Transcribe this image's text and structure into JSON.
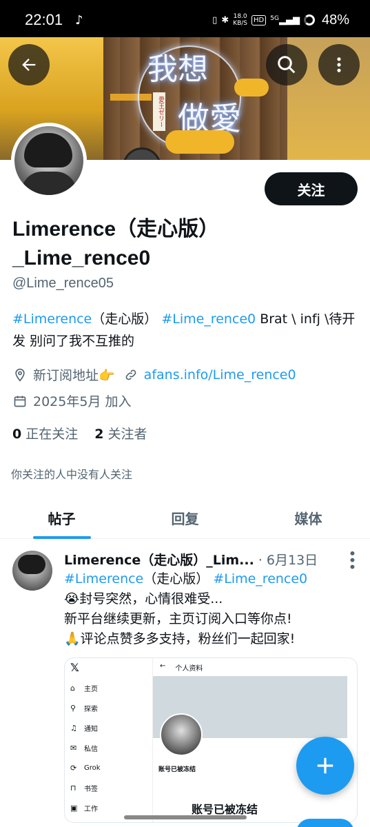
{
  "status_bar": {
    "time": "22:01",
    "net_speed_value": "18.0",
    "net_speed_unit": "KB/S",
    "hd_label": "HD",
    "signal_label": "5G",
    "battery": "48%"
  },
  "banner": {
    "neon_line1": "我想",
    "neon_line2": "做愛",
    "tag_text": "愛王ゼリー"
  },
  "profile": {
    "follow_label": "关注",
    "name": "Limerence（走心版）_Lime_rence0",
    "handle": "@Lime_rence05",
    "bio_tag1": "#Limerence",
    "bio_text1": "（走心版）",
    "bio_tag2": "#Lime_rence0",
    "bio_text2": " Brat \\ infj \\待开发 别问了我不互推的",
    "location": "新订阅地址👉",
    "website": "afans.info/Lime_rence0",
    "joined": "2025年5月 加入",
    "following_count": "0",
    "following_label": "正在关注",
    "followers_count": "2",
    "followers_label": "关注者",
    "no_mutuals": "你关注的人中没有人关注"
  },
  "tabs": [
    {
      "label": "帖子",
      "active": true
    },
    {
      "label": "回复",
      "active": false
    },
    {
      "label": "媒体",
      "active": false
    }
  ],
  "tweet": {
    "author": "Limerence（走心版）_Lim...",
    "date": "· 6月13日",
    "tag1": "#Limerence",
    "text1": "（走心版）",
    "tag2": "#Lime_rence0",
    "line2": "😭封号突然，心情很难受...",
    "line3": "新平台继续更新，主页订阅入口等你点!",
    "line4": "🙏评论点赞多多支持，粉丝们一起回家!"
  },
  "embed": {
    "x_logo": "𝕏",
    "nav": [
      {
        "icon": "⌂",
        "label": "主页"
      },
      {
        "icon": "⚲",
        "label": "探索"
      },
      {
        "icon": "♫",
        "label": "通知"
      },
      {
        "icon": "✉",
        "label": "私信"
      },
      {
        "icon": "⟳",
        "label": "Grok"
      },
      {
        "icon": "⊓",
        "label": "书签"
      },
      {
        "icon": "▣",
        "label": "工作"
      }
    ],
    "back": "←",
    "header": "个人资料",
    "frozen_small": "账号已被冻结",
    "frozen_big": "账号已被冻结"
  },
  "colors": {
    "accent": "#1d9bf0",
    "text": "#0f1419",
    "muted": "#536471"
  }
}
